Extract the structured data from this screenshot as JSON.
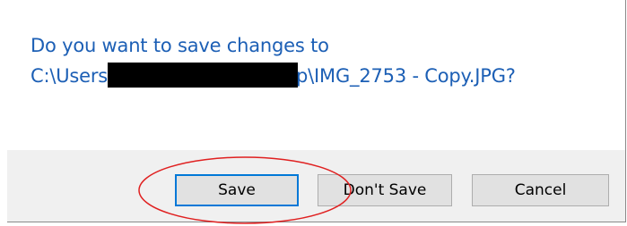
{
  "dialog": {
    "message_line1": "Do you want to save changes to",
    "path_prefix": "C:\\Users",
    "path_redacted_tail": "p",
    "path_suffix": "\\IMG_2753 - Copy.JPG?"
  },
  "buttons": {
    "save_label": "Save",
    "dont_save_label": "Don't Save",
    "cancel_label": "Cancel"
  },
  "colors": {
    "message_text": "#1c5fb5",
    "button_bar": "#f0f0f0",
    "default_button_border": "#0078d7",
    "annotation": "#e02020"
  },
  "annotation": {
    "shape": "ellipse",
    "target": "save-button"
  }
}
